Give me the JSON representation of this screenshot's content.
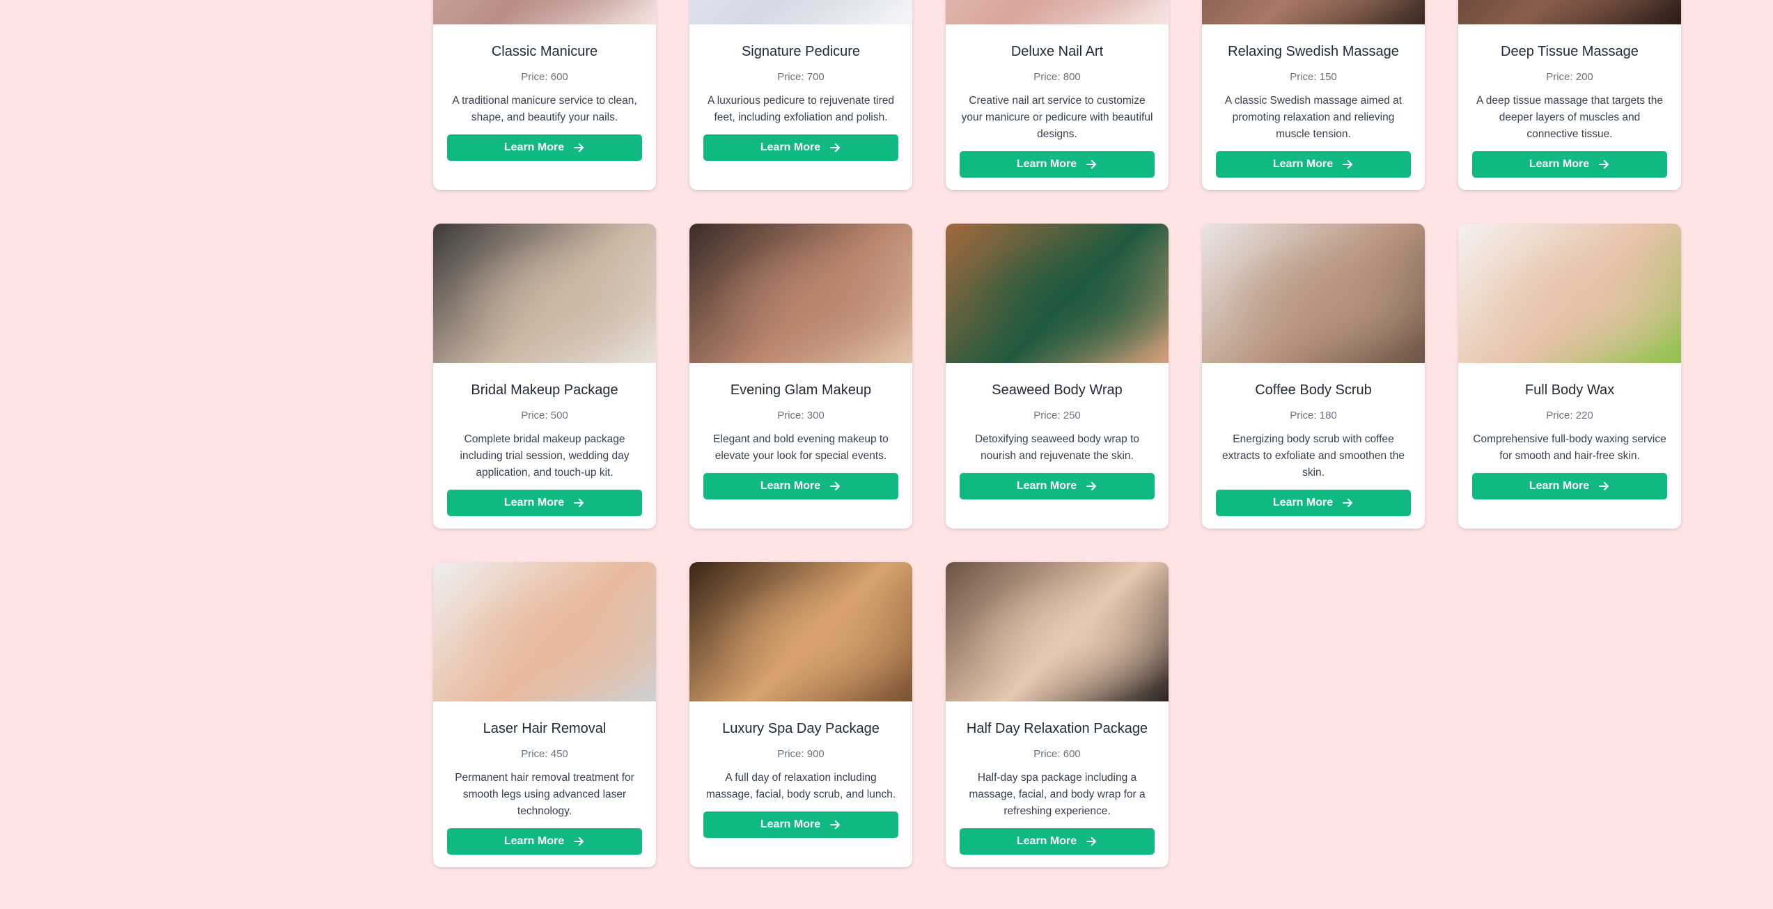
{
  "services": [
    {
      "title": "Classic Manicure",
      "price": "Price: 600",
      "description": "A traditional manicure service to clean, shape, and beautify your nails.",
      "button": "Learn More",
      "colors": [
        "#d9b6b0",
        "#b98d86",
        "#f3e3df"
      ]
    },
    {
      "title": "Signature Pedicure",
      "price": "Price: 700",
      "description": "A luxurious pedicure to rejuvenate tired feet, including exfoliation and polish.",
      "button": "Learn More",
      "colors": [
        "#e8ecf3",
        "#d4d9e4",
        "#f4f6fa"
      ]
    },
    {
      "title": "Deluxe Nail Art",
      "price": "Price: 800",
      "description": "Creative nail art service to customize your manicure or pedicure with beautiful designs.",
      "button": "Learn More",
      "colors": [
        "#e9c7c2",
        "#d8a59c",
        "#f6e6e3"
      ]
    },
    {
      "title": "Relaxing Swedish Massage",
      "price": "Price: 150",
      "description": "A classic Swedish massage aimed at promoting relaxation and relieving muscle tension.",
      "button": "Learn More",
      "colors": [
        "#6b4a3a",
        "#a87864",
        "#3a2a22"
      ]
    },
    {
      "title": "Deep Tissue Massage",
      "price": "Price: 200",
      "description": "A deep tissue massage that targets the deeper layers of muscles and connective tissue.",
      "button": "Learn More",
      "colors": [
        "#4a3128",
        "#8a5e4c",
        "#2b1d18"
      ]
    },
    {
      "title": "Bridal Makeup Package",
      "price": "Price: 500",
      "description": "Complete bridal makeup package including trial session, wedding day application, and touch-up kit.",
      "button": "Learn More",
      "colors": [
        "#3d3a38",
        "#c9b7a4",
        "#e7e1d9"
      ]
    },
    {
      "title": "Evening Glam Makeup",
      "price": "Price: 300",
      "description": "Elegant and bold evening makeup to elevate your look for special events.",
      "button": "Learn More",
      "colors": [
        "#3a2d28",
        "#b8846c",
        "#e2c3a8"
      ]
    },
    {
      "title": "Seaweed Body Wrap",
      "price": "Price: 250",
      "description": "Detoxifying seaweed body wrap to nourish and rejuvenate the skin.",
      "button": "Learn More",
      "colors": [
        "#a4683e",
        "#1f5a3e",
        "#d6a079"
      ]
    },
    {
      "title": "Coffee Body Scrub",
      "price": "Price: 180",
      "description": "Energizing body scrub with coffee extracts to exfoliate and smoothen the skin.",
      "button": "Learn More",
      "colors": [
        "#e9e6e3",
        "#b89580",
        "#6e5445"
      ]
    },
    {
      "title": "Full Body Wax",
      "price": "Price: 220",
      "description": "Comprehensive full-body waxing service for smooth and hair-free skin.",
      "button": "Learn More",
      "colors": [
        "#f4f1ee",
        "#e6c2a8",
        "#8fc24a"
      ]
    },
    {
      "title": "Laser Hair Removal",
      "price": "Price: 450",
      "description": "Permanent hair removal treatment for smooth legs using advanced laser technology.",
      "button": "Learn More",
      "colors": [
        "#eeeeee",
        "#e8b99c",
        "#cfcfcf"
      ]
    },
    {
      "title": "Luxury Spa Day Package",
      "price": "Price: 900",
      "description": "A full day of relaxation including massage, facial, body scrub, and lunch.",
      "button": "Learn More",
      "colors": [
        "#3b2617",
        "#d8a36e",
        "#7a5232"
      ]
    },
    {
      "title": "Half Day Relaxation Package",
      "price": "Price: 600",
      "description": "Half-day spa package including a massage, facial, and body wrap for a refreshing experience.",
      "button": "Learn More",
      "colors": [
        "#6a5244",
        "#e8c8b0",
        "#2a2320"
      ]
    }
  ],
  "accent": "#10b981",
  "background": "#ffe4e6"
}
